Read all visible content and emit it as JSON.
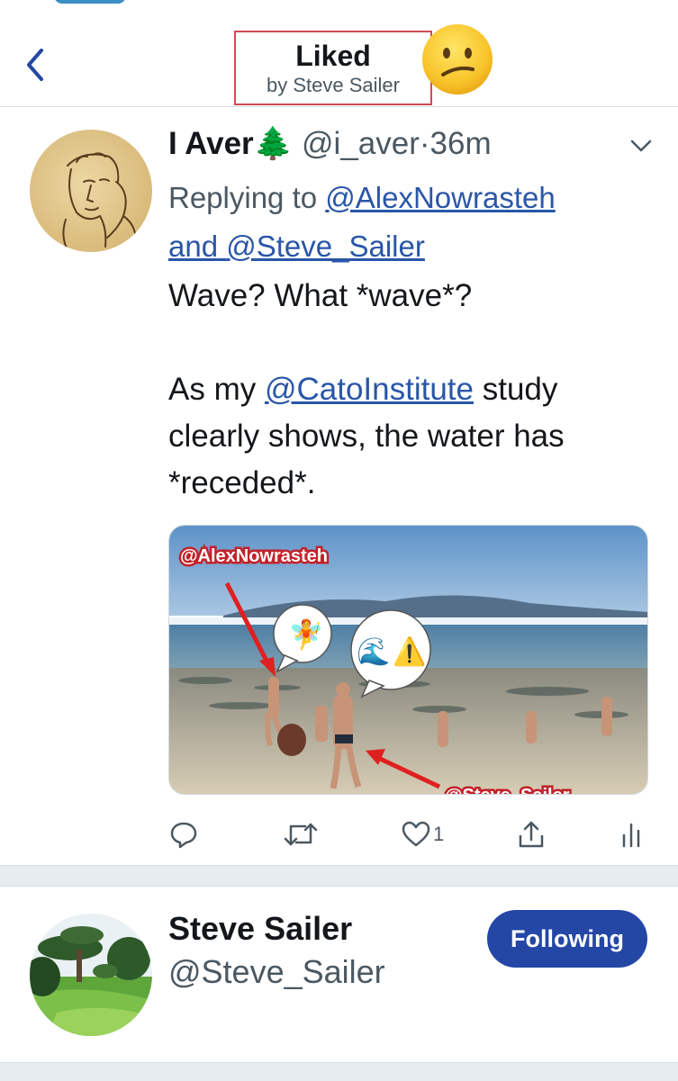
{
  "header": {
    "title": "Liked",
    "subtitle": "by Steve Sailer",
    "reaction_emoji": "confused-face"
  },
  "tweet": {
    "author_name": "I Aver",
    "author_emoji": "🌲",
    "handle": "@i_aver",
    "separator": "·",
    "time": "36m",
    "replying_prefix": "Replying to",
    "replying_to_1": "@AlexNowrasteh",
    "replying_and": "and",
    "replying_to_2": "@Steve_Sailer",
    "text_line1": "Wave? What *wave*?",
    "text_pre_link": "As my",
    "text_link": "@CatoInstitute",
    "text_post_link": " study clearly shows, the water has *receded*.",
    "media": {
      "label_top": "@AlexNowrasteh",
      "label_bottom": "@Steve_Sailer",
      "bubble1_emoji": "🧚",
      "bubble2_emoji_a": "🌊",
      "bubble2_emoji_b": "⚠️"
    },
    "actions": {
      "reply_icon": "reply-icon",
      "retweet_icon": "retweet-icon",
      "like_icon": "heart-icon",
      "like_count": "1",
      "share_icon": "share-icon",
      "analytics_icon": "analytics-icon"
    }
  },
  "user_card": {
    "name": "Steve Sailer",
    "handle": "@Steve_Sailer",
    "follow_button": "Following"
  },
  "colors": {
    "link": "#2a56a8",
    "follow_button": "#2447a6",
    "highlight_border": "#d24a55"
  }
}
